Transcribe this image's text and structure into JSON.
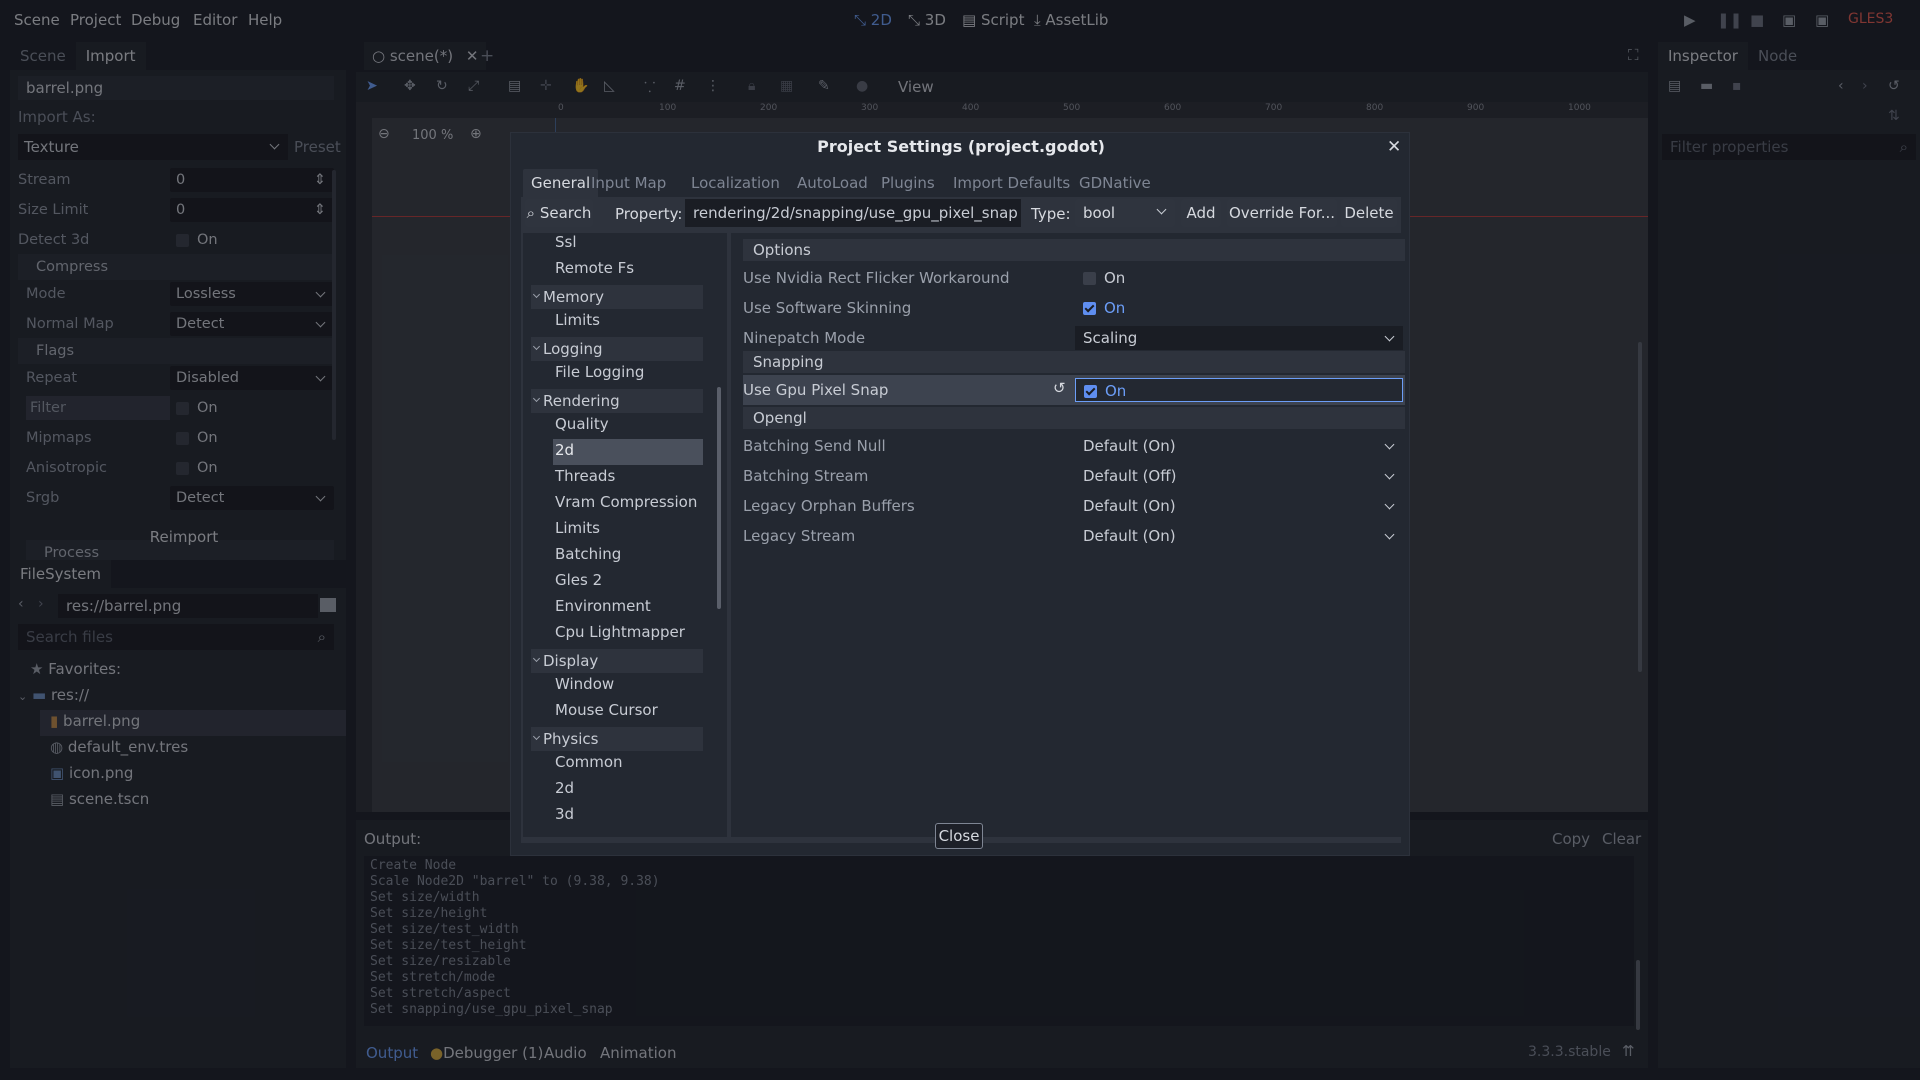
{
  "menu": {
    "items": [
      "Scene",
      "Project",
      "Debug",
      "Editor",
      "Help"
    ]
  },
  "workspaces": {
    "two_d": "2D",
    "three_d": "3D",
    "script": "Script",
    "assetlib": "AssetLib"
  },
  "renderer": "GLES3",
  "left_dock": {
    "tabs": [
      "Scene",
      "Import"
    ],
    "file": "barrel.png",
    "import_as_label": "Import As:",
    "import_as_value": "Texture",
    "preset": "Preset",
    "props": [
      {
        "label": "Stream",
        "value": "0"
      },
      {
        "label": "Size Limit",
        "value": "0"
      },
      {
        "label": "Detect 3d",
        "value": "On"
      }
    ],
    "compress_section": "Compress",
    "compress_props": [
      {
        "label": "Mode",
        "value": "Lossless"
      },
      {
        "label": "Normal Map",
        "value": "Detect"
      }
    ],
    "flags_section": "Flags",
    "flag_props": [
      {
        "label": "Repeat",
        "value": "Disabled"
      },
      {
        "label": "Filter",
        "value": "On"
      },
      {
        "label": "Mipmaps",
        "value": "On"
      },
      {
        "label": "Anisotropic",
        "value": "On"
      },
      {
        "label": "Srgb",
        "value": "Detect"
      }
    ],
    "process_section": "Process",
    "reimport": "Reimport"
  },
  "filesystem": {
    "title": "FileSystem",
    "path": "res://barrel.png",
    "search_placeholder": "Search files",
    "favorites": "Favorites:",
    "root": "res://",
    "files": [
      "barrel.png",
      "default_env.tres",
      "icon.png",
      "scene.tscn"
    ]
  },
  "scene_tab": "scene(*)",
  "toolbar": {
    "view": "View",
    "zoom": "100 %"
  },
  "ruler": [
    "0",
    "100",
    "200",
    "300",
    "400",
    "500",
    "600",
    "700",
    "800",
    "900",
    "1000"
  ],
  "inspector": {
    "tabs": [
      "Inspector",
      "Node"
    ],
    "filter_placeholder": "Filter properties"
  },
  "output": {
    "label": "Output:",
    "copy": "Copy",
    "clear": "Clear",
    "lines": [
      "Create Node",
      "Scale Node2D \"barrel\" to (9.38, 9.38)",
      "Set size/width",
      "Set size/height",
      "Set size/test_width",
      "Set size/test_height",
      "Set size/resizable",
      "Set stretch/mode",
      "Set stretch/aspect",
      "Set snapping/use_gpu_pixel_snap"
    ],
    "bottom_tabs": [
      "Output",
      "Debugger (1)",
      "Audio",
      "Animation"
    ],
    "version": "3.3.3.stable"
  },
  "dialog": {
    "title": "Project Settings (project.godot)",
    "tabs": [
      "General",
      "Input Map",
      "Localization",
      "AutoLoad",
      "Plugins",
      "Import Defaults",
      "GDNative"
    ],
    "search": "Search",
    "property_label": "Property:",
    "property_value": "rendering/2d/snapping/use_gpu_pixel_snap",
    "type_label": "Type:",
    "type_value": "bool",
    "add": "Add",
    "override": "Override For...",
    "delete": "Delete",
    "close": "Close",
    "tree": {
      "ssl": "Ssl",
      "remote_fs": "Remote Fs",
      "memory": "Memory",
      "limits1": "Limits",
      "logging": "Logging",
      "file_logging": "File Logging",
      "rendering": "Rendering",
      "quality": "Quality",
      "two_d": "2d",
      "threads": "Threads",
      "vram": "Vram Compression",
      "limits2": "Limits",
      "batching": "Batching",
      "gles2": "Gles 2",
      "environment": "Environment",
      "cpu": "Cpu Lightmapper",
      "display": "Display",
      "window": "Window",
      "mouse": "Mouse Cursor",
      "physics": "Physics",
      "common": "Common",
      "p2d": "2d",
      "p3d": "3d"
    },
    "options_head": "Options",
    "options": [
      {
        "label": "Use Nvidia Rect Flicker Workaround",
        "value": "On"
      },
      {
        "label": "Use Software Skinning",
        "value": "On"
      },
      {
        "label": "Ninepatch Mode",
        "value": "Scaling"
      }
    ],
    "snapping_head": "Snapping",
    "snap": {
      "label": "Use Gpu Pixel Snap",
      "value": "On"
    },
    "opengl_head": "Opengl",
    "opengl": [
      {
        "label": "Batching Send Null",
        "value": "Default (On)"
      },
      {
        "label": "Batching Stream",
        "value": "Default (Off)"
      },
      {
        "label": "Legacy Orphan Buffers",
        "value": "Default (On)"
      },
      {
        "label": "Legacy Stream",
        "value": "Default (On)"
      }
    ]
  }
}
